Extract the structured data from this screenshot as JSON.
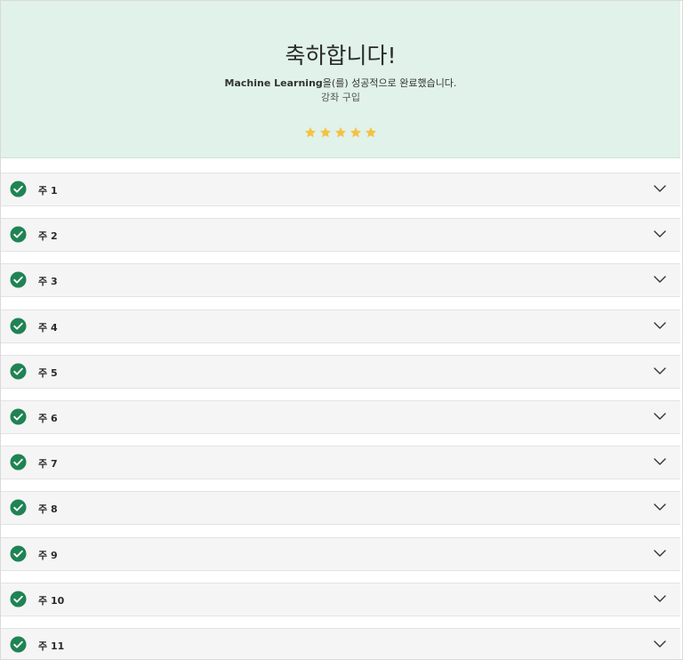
{
  "menu": {
    "more_label": "···"
  },
  "hero": {
    "title": "축하합니다!",
    "course_name": "Machine Learning",
    "message_suffix": "을(를) 성공적으로 완료했습니다.",
    "buy_link": "강좌 구입",
    "rating": 5,
    "rating_max": 5,
    "star_color": "#f5c242"
  },
  "weeks": [
    {
      "label": "주 1"
    },
    {
      "label": "주 2"
    },
    {
      "label": "주 3"
    },
    {
      "label": "주 4"
    },
    {
      "label": "주 5"
    },
    {
      "label": "주 6"
    },
    {
      "label": "주 7"
    },
    {
      "label": "주 8"
    },
    {
      "label": "주 9"
    },
    {
      "label": "주 10"
    },
    {
      "label": "주 11"
    }
  ],
  "colors": {
    "hero_bg": "#e0f2e9",
    "check_green": "#1f8354",
    "row_bg": "#f5f5f5"
  }
}
